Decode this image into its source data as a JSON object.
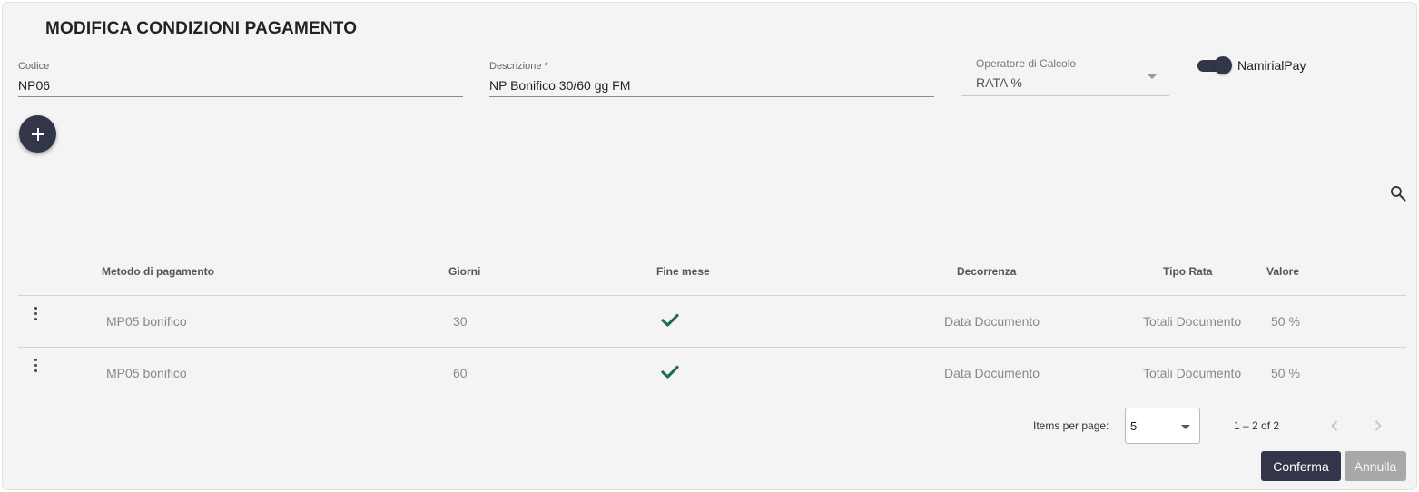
{
  "dialog": {
    "title": "MODIFICA CONDIZIONI PAGAMENTO"
  },
  "form": {
    "codice": {
      "label": "Codice",
      "value": "NP06"
    },
    "descrizione": {
      "label": "Descrizione *",
      "value": "NP Bonifico 30/60 gg FM"
    },
    "operatore": {
      "label": "Operatore di Calcolo",
      "value": "RATA %"
    },
    "toggle": {
      "label": "NamirialPay",
      "checked": true
    }
  },
  "icons": {
    "add": "plus-icon",
    "search": "search-icon",
    "row_menu": "more-vert-icon",
    "check": "check-icon",
    "prev": "chevron-left-icon",
    "next": "chevron-right-icon"
  },
  "table": {
    "headers": {
      "metodo": "Metodo di pagamento",
      "giorni": "Giorni",
      "fine_mese": "Fine mese",
      "decorrenza": "Decorrenza",
      "tipo_rata": "Tipo Rata",
      "valore": "Valore"
    },
    "rows": [
      {
        "metodo": "MP05 bonifico",
        "giorni": "30",
        "fine_mese": true,
        "decorrenza": "Data Documento",
        "tipo_rata": "Totali Documento",
        "valore": "50 %"
      },
      {
        "metodo": "MP05 bonifico",
        "giorni": "60",
        "fine_mese": true,
        "decorrenza": "Data Documento",
        "tipo_rata": "Totali Documento",
        "valore": "50 %"
      }
    ]
  },
  "paginator": {
    "items_label": "Items per page:",
    "page_size": "5",
    "range": "1 – 2 of 2"
  },
  "actions": {
    "confirm": "Conferma",
    "cancel": "Annulla"
  },
  "colors": {
    "primary": "#333548",
    "check": "#1e6e4e",
    "disabled": "#a8a8a8",
    "background": "#f4f4f4"
  }
}
